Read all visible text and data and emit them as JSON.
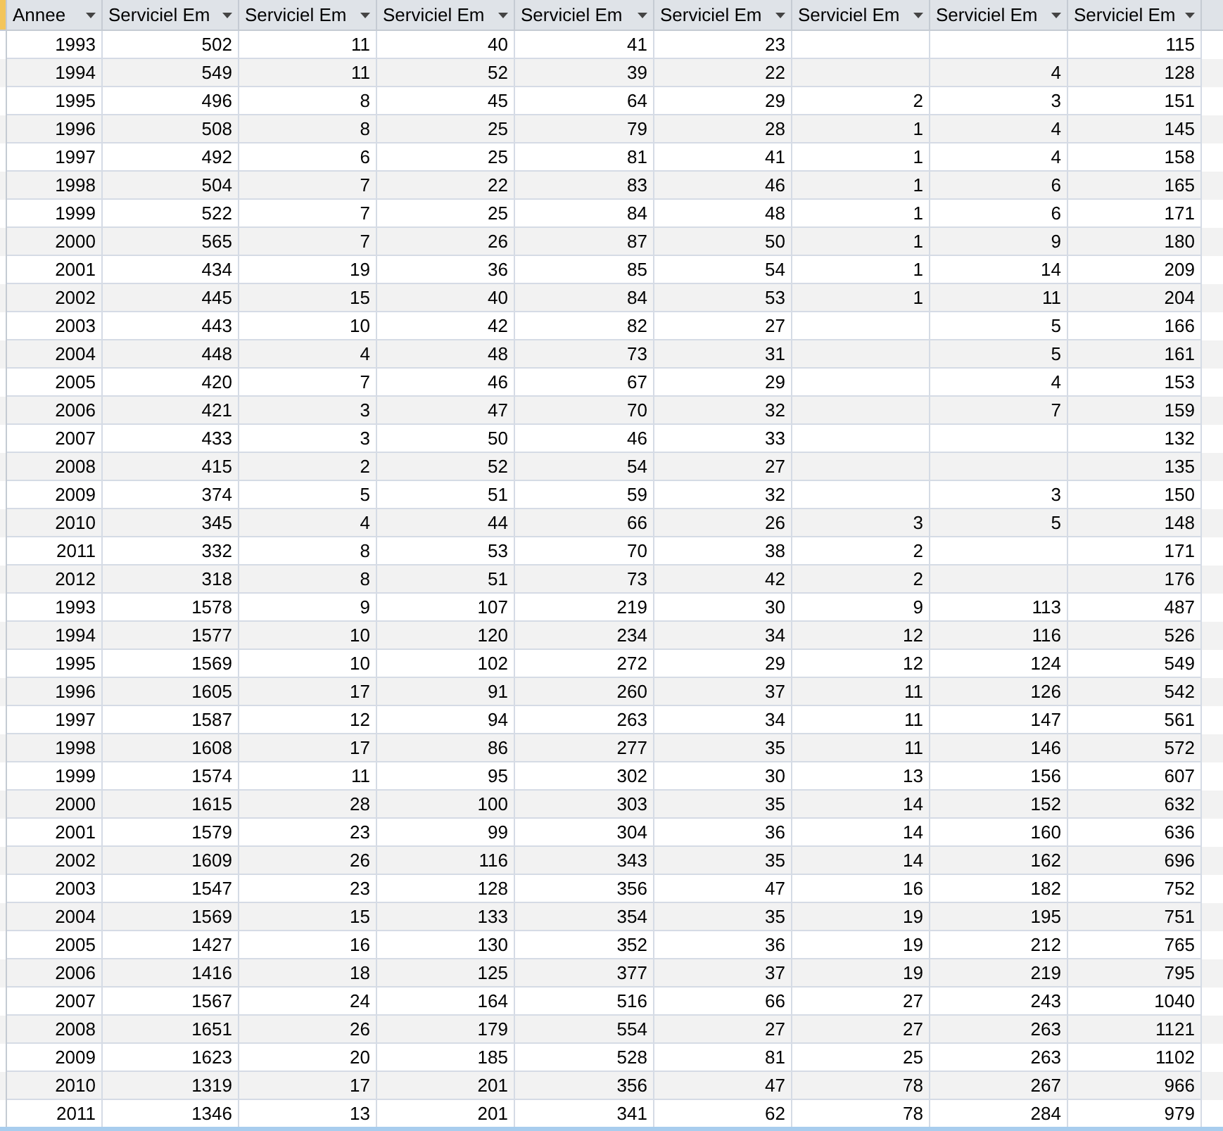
{
  "table": {
    "columns": [
      "Annee",
      "Serviciel Em",
      "Serviciel Em",
      "Serviciel Em",
      "Serviciel Em",
      "Serviciel Em",
      "Serviciel Em",
      "Serviciel Em",
      "Serviciel Em"
    ],
    "rows": [
      [
        "1993",
        "502",
        "11",
        "40",
        "41",
        "23",
        null,
        null,
        "115"
      ],
      [
        "1994",
        "549",
        "11",
        "52",
        "39",
        "22",
        null,
        "4",
        "128"
      ],
      [
        "1995",
        "496",
        "8",
        "45",
        "64",
        "29",
        "2",
        "3",
        "151"
      ],
      [
        "1996",
        "508",
        "8",
        "25",
        "79",
        "28",
        "1",
        "4",
        "145"
      ],
      [
        "1997",
        "492",
        "6",
        "25",
        "81",
        "41",
        "1",
        "4",
        "158"
      ],
      [
        "1998",
        "504",
        "7",
        "22",
        "83",
        "46",
        "1",
        "6",
        "165"
      ],
      [
        "1999",
        "522",
        "7",
        "25",
        "84",
        "48",
        "1",
        "6",
        "171"
      ],
      [
        "2000",
        "565",
        "7",
        "26",
        "87",
        "50",
        "1",
        "9",
        "180"
      ],
      [
        "2001",
        "434",
        "19",
        "36",
        "85",
        "54",
        "1",
        "14",
        "209"
      ],
      [
        "2002",
        "445",
        "15",
        "40",
        "84",
        "53",
        "1",
        "11",
        "204"
      ],
      [
        "2003",
        "443",
        "10",
        "42",
        "82",
        "27",
        null,
        "5",
        "166"
      ],
      [
        "2004",
        "448",
        "4",
        "48",
        "73",
        "31",
        null,
        "5",
        "161"
      ],
      [
        "2005",
        "420",
        "7",
        "46",
        "67",
        "29",
        null,
        "4",
        "153"
      ],
      [
        "2006",
        "421",
        "3",
        "47",
        "70",
        "32",
        null,
        "7",
        "159"
      ],
      [
        "2007",
        "433",
        "3",
        "50",
        "46",
        "33",
        null,
        null,
        "132"
      ],
      [
        "2008",
        "415",
        "2",
        "52",
        "54",
        "27",
        null,
        null,
        "135"
      ],
      [
        "2009",
        "374",
        "5",
        "51",
        "59",
        "32",
        null,
        "3",
        "150"
      ],
      [
        "2010",
        "345",
        "4",
        "44",
        "66",
        "26",
        "3",
        "5",
        "148"
      ],
      [
        "2011",
        "332",
        "8",
        "53",
        "70",
        "38",
        "2",
        null,
        "171"
      ],
      [
        "2012",
        "318",
        "8",
        "51",
        "73",
        "42",
        "2",
        null,
        "176"
      ],
      [
        "1993",
        "1578",
        "9",
        "107",
        "219",
        "30",
        "9",
        "113",
        "487"
      ],
      [
        "1994",
        "1577",
        "10",
        "120",
        "234",
        "34",
        "12",
        "116",
        "526"
      ],
      [
        "1995",
        "1569",
        "10",
        "102",
        "272",
        "29",
        "12",
        "124",
        "549"
      ],
      [
        "1996",
        "1605",
        "17",
        "91",
        "260",
        "37",
        "11",
        "126",
        "542"
      ],
      [
        "1997",
        "1587",
        "12",
        "94",
        "263",
        "34",
        "11",
        "147",
        "561"
      ],
      [
        "1998",
        "1608",
        "17",
        "86",
        "277",
        "35",
        "11",
        "146",
        "572"
      ],
      [
        "1999",
        "1574",
        "11",
        "95",
        "302",
        "30",
        "13",
        "156",
        "607"
      ],
      [
        "2000",
        "1615",
        "28",
        "100",
        "303",
        "35",
        "14",
        "152",
        "632"
      ],
      [
        "2001",
        "1579",
        "23",
        "99",
        "304",
        "36",
        "14",
        "160",
        "636"
      ],
      [
        "2002",
        "1609",
        "26",
        "116",
        "343",
        "35",
        "14",
        "162",
        "696"
      ],
      [
        "2003",
        "1547",
        "23",
        "128",
        "356",
        "47",
        "16",
        "182",
        "752"
      ],
      [
        "2004",
        "1569",
        "15",
        "133",
        "354",
        "35",
        "19",
        "195",
        "751"
      ],
      [
        "2005",
        "1427",
        "16",
        "130",
        "352",
        "36",
        "19",
        "212",
        "765"
      ],
      [
        "2006",
        "1416",
        "18",
        "125",
        "377",
        "37",
        "19",
        "219",
        "795"
      ],
      [
        "2007",
        "1567",
        "24",
        "164",
        "516",
        "66",
        "27",
        "243",
        "1040"
      ],
      [
        "2008",
        "1651",
        "26",
        "179",
        "554",
        "27",
        "27",
        "263",
        "1121"
      ],
      [
        "2009",
        "1623",
        "20",
        "185",
        "528",
        "81",
        "25",
        "263",
        "1102"
      ],
      [
        "2010",
        "1319",
        "17",
        "201",
        "356",
        "47",
        "78",
        "267",
        "966"
      ],
      [
        "2011",
        "1346",
        "13",
        "201",
        "341",
        "62",
        "78",
        "284",
        "979"
      ]
    ]
  }
}
